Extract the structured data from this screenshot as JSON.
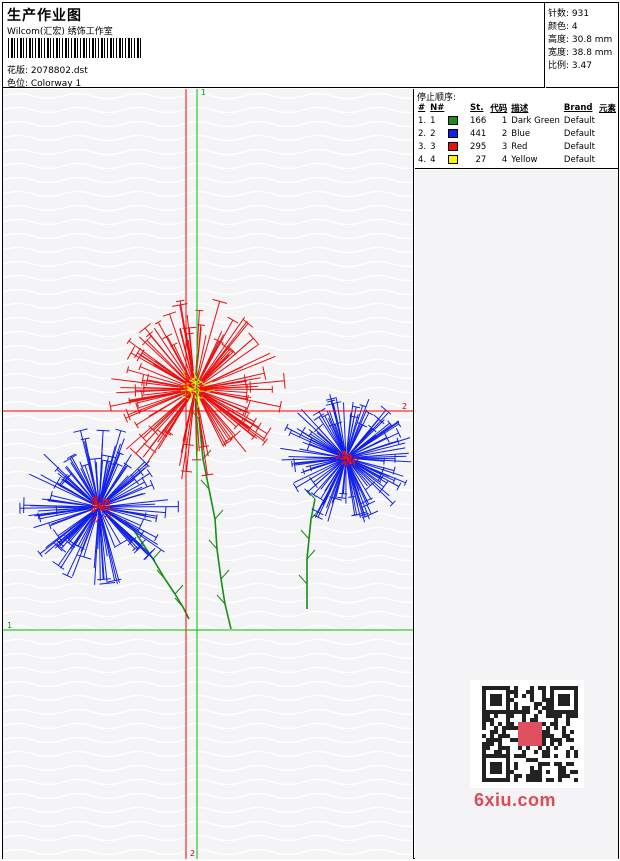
{
  "header": {
    "title": "生产作业图",
    "vendor": "Wilcom(汇宏) 绣饰工作室",
    "design_label": "花版: 2078802.dst",
    "colorway_label": "色位: Colorway 1"
  },
  "stats": {
    "stitches": "针数: 931",
    "colors": "颜色: 4",
    "height": "高度: 30.8 mm",
    "width": "宽度: 38.8 mm",
    "scale": "比例: 3.47"
  },
  "sequence": {
    "title": "停止顺序:",
    "headers": [
      "#",
      "N#",
      "St.",
      "代码",
      "描述",
      "Brand",
      "元素"
    ],
    "rows": [
      {
        "idx": "1.",
        "n": "1",
        "color": "#1a8c1a",
        "stitches": "166",
        "code": "1",
        "desc": "Dark Green",
        "brand": "Default"
      },
      {
        "idx": "2.",
        "n": "2",
        "color": "#1020e8",
        "stitches": "441",
        "code": "2",
        "desc": "Blue",
        "brand": "Default"
      },
      {
        "idx": "3.",
        "n": "3",
        "color": "#e81010",
        "stitches": "295",
        "code": "3",
        "desc": "Red",
        "brand": "Default"
      },
      {
        "idx": "4.",
        "n": "4",
        "color": "#f8f800",
        "stitches": "27",
        "code": "4",
        "desc": "Yellow",
        "brand": "Default"
      }
    ]
  },
  "guides": {
    "v_green": "1",
    "v_red": "2",
    "h_red": "2",
    "h_green": "1"
  },
  "watermark": "6xiu.com",
  "colors": {
    "green": "#1a8c1a",
    "blue": "#1020e8",
    "red": "#e81010",
    "yellow": "#f8f800",
    "guide_red": "#ff0000",
    "guide_green": "#00c000"
  }
}
